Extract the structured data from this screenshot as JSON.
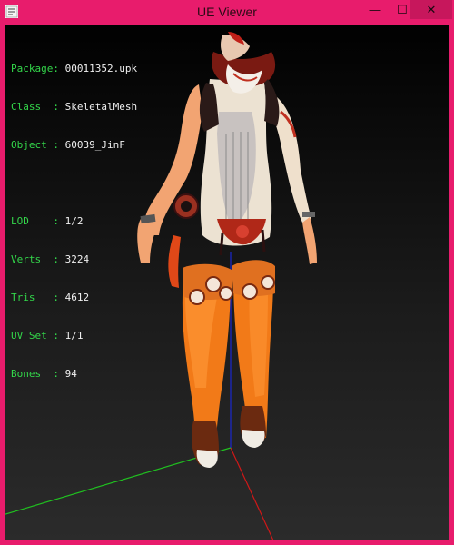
{
  "window": {
    "title": "UE Viewer",
    "minimize_glyph": "—",
    "maximize_glyph": "☐",
    "close_glyph": "✕"
  },
  "info": {
    "package": {
      "key": "Package",
      "value": "00011352.upk"
    },
    "class": {
      "key": "Class  ",
      "value": "SkeletalMesh"
    },
    "object": {
      "key": "Object ",
      "value": "60039_JinF"
    },
    "lod": {
      "key": "LOD    ",
      "value": "1/2"
    },
    "verts": {
      "key": "Verts  ",
      "value": "3224"
    },
    "tris": {
      "key": "Tris   ",
      "value": "4612"
    },
    "uvset": {
      "key": "UV Set ",
      "value": "1/1"
    },
    "bones": {
      "key": "Bones  ",
      "value": "94"
    }
  },
  "colors": {
    "frame": "#e81c6c",
    "hud_key": "#33d64a",
    "hud_value": "#f0f0f0",
    "axis_x": "#d01818",
    "axis_y": "#1a28d0",
    "axis_z": "#20c020"
  },
  "icons": {
    "app": "ue-viewer-app-icon",
    "minimize": "minimize-icon",
    "maximize": "maximize-icon",
    "close": "close-icon"
  }
}
